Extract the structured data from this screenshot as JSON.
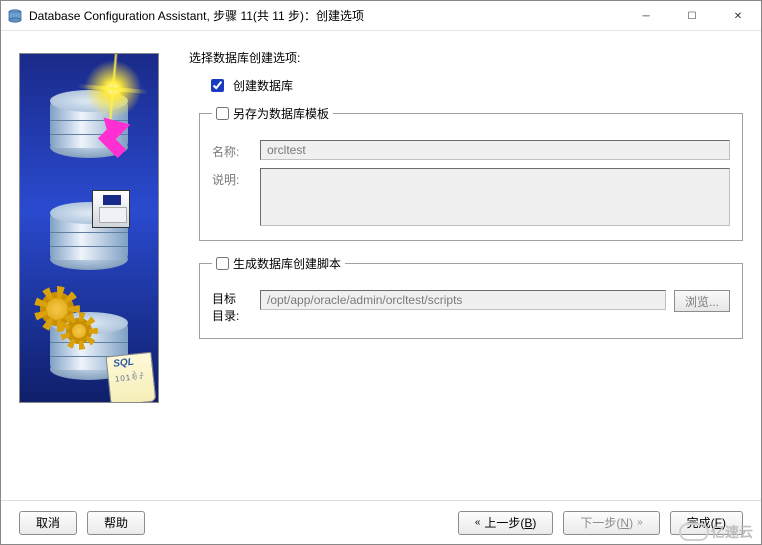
{
  "window": {
    "title": "Database Configuration Assistant, 步骤 11(共 11 步)：创建选项"
  },
  "form": {
    "prompt": "选择数据库创建选项:",
    "create_db": {
      "label": "创建数据库",
      "checked": true
    },
    "save_template": {
      "legend": "另存为数据库模板",
      "checked": false,
      "name_label": "名称:",
      "name_value": "orcltest",
      "desc_label": "说明:",
      "desc_value": ""
    },
    "gen_scripts": {
      "legend": "生成数据库创建脚本",
      "checked": false,
      "target_label_1": "目标",
      "target_label_2": "目录:",
      "target_value": "/opt/app/oracle/admin/orcltest/scripts",
      "browse_label": "浏览..."
    }
  },
  "footer": {
    "cancel": "取消",
    "help": "帮助",
    "back": "上一步(B)",
    "next": "下一步(N)",
    "finish": "完成(F)"
  },
  "watermark": "亿速云"
}
